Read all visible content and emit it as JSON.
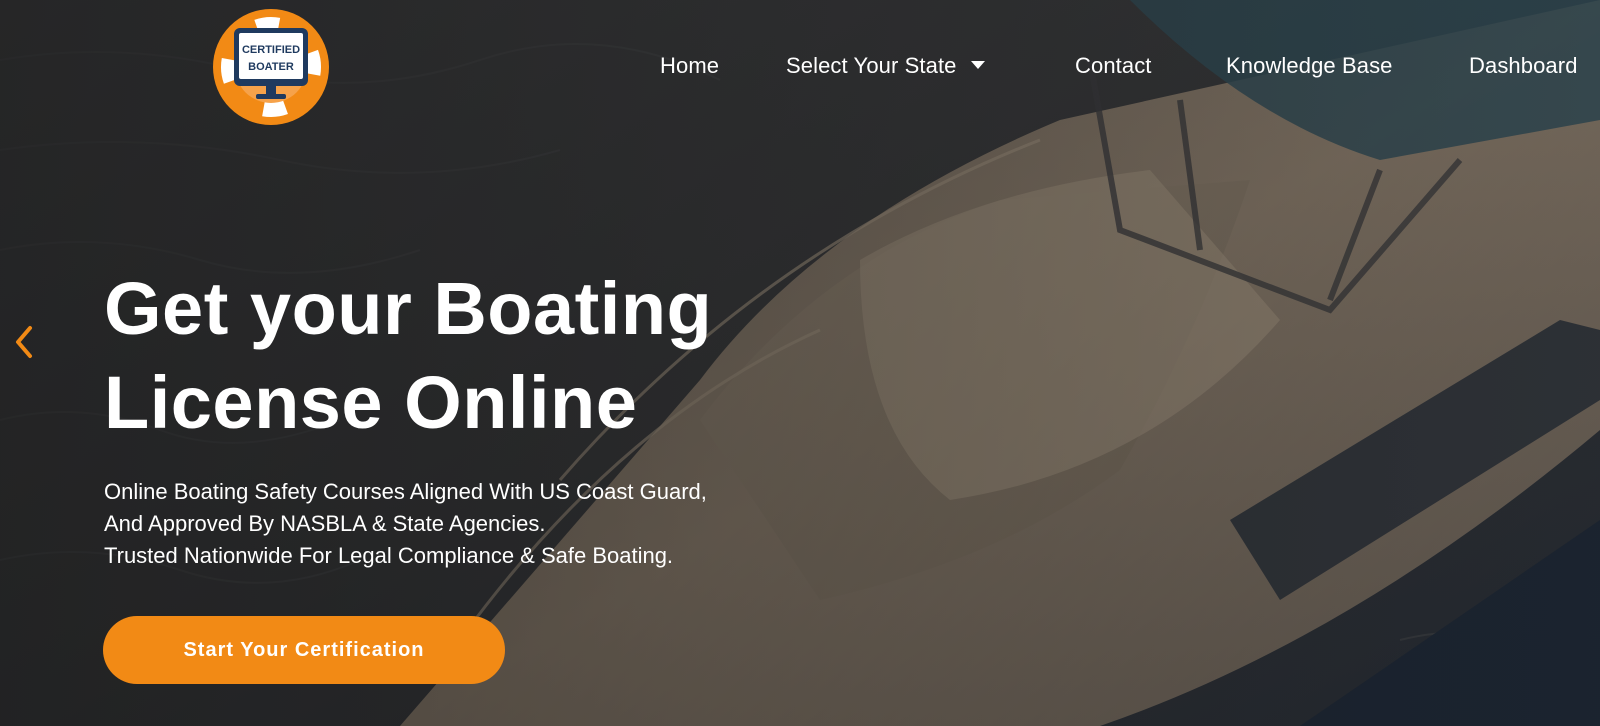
{
  "logo": {
    "line1": "CERTIFIED",
    "line2": "BOATER",
    "icon": "life-ring-monitor-icon",
    "accent_color": "#f28a15",
    "screen_color": "#1f3a5f"
  },
  "nav": {
    "items": [
      {
        "label": "Home"
      },
      {
        "label": "Select Your State",
        "has_dropdown": true
      },
      {
        "label": "Contact"
      },
      {
        "label": "Knowledge Base"
      },
      {
        "label": "Dashboard"
      }
    ]
  },
  "slider": {
    "prev_icon": "chevron-left-icon",
    "arrow_color": "#f28a15"
  },
  "hero": {
    "headline_line1": "Get your Boating",
    "headline_line2": "License Online",
    "sub_line1": "Online Boating Safety Courses Aligned With US Coast Guard,",
    "sub_line2": "And Approved By NASBLA & State Agencies.",
    "sub_line3": "Trusted Nationwide For Legal Compliance & Safe Boating.",
    "cta_label": "Start Your Certification",
    "cta_color": "#f28a15",
    "background": "aerial-yacht-on-water-image"
  }
}
